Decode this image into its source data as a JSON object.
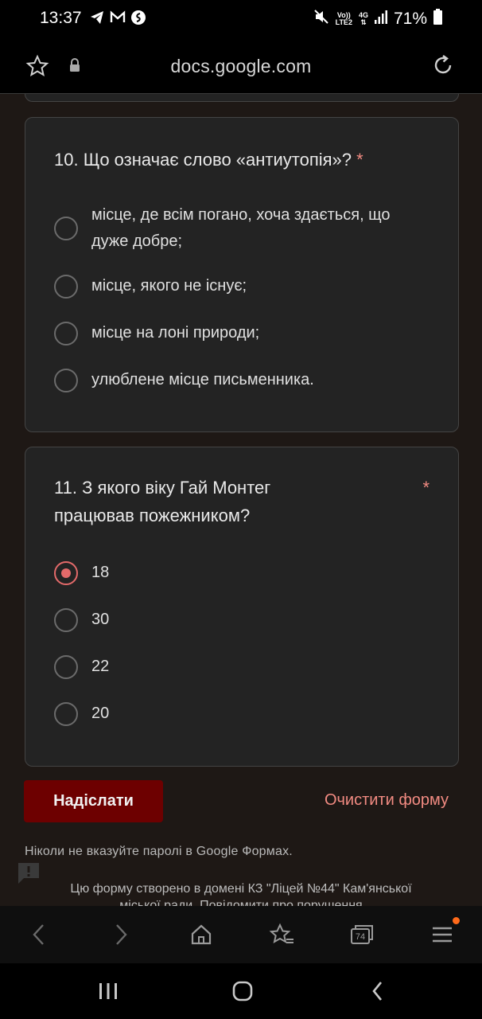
{
  "status_bar": {
    "time": "13:37",
    "net_label_top": "Vo))",
    "net_label_bottom": "LTE2",
    "net_type": "4G",
    "battery": "71%"
  },
  "address_bar": {
    "url": "docs.google.com"
  },
  "form": {
    "q10": {
      "title": "10. Що означає слово «антиутопія»?",
      "required_mark": "*",
      "options": [
        "місце, де всім погано, хоча здається, що дуже добре;",
        "місце, якого не існує;",
        "місце на лоні природи;",
        "улюблене місце письменника."
      ],
      "selected_index": -1
    },
    "q11": {
      "title_line1": "11. З якого віку Гай Монтег",
      "title_line2": "працював пожежником?",
      "required_mark": "*",
      "options": [
        "18",
        "30",
        "22",
        "20"
      ],
      "selected_index": 0
    },
    "submit_label": "Надіслати",
    "clear_label": "Очистити форму",
    "password_hint": "Ніколи не вказуйте паролі в Google Формах.",
    "footer_line1": "Цю форму створено в домені КЗ \"Ліцей №44\" Кам'янської",
    "footer_line2": "міської ради. Повідомити про порушення"
  },
  "browser_toolbar": {
    "tabs_count": "74"
  },
  "colors": {
    "accent": "#f28b82",
    "submit_bg": "#6d0000",
    "radio_selected": "#e36a6a",
    "page_bg": "#1e1815",
    "card_bg": "#232323"
  }
}
